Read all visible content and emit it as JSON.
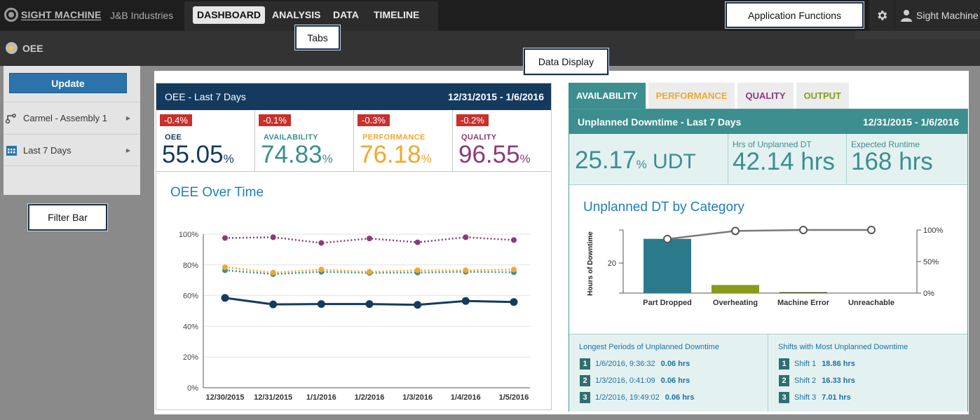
{
  "topbar": {
    "brand": "SIGHT MACHINE",
    "company": "J&B Industries",
    "tabs": [
      "DASHBOARD",
      "ANALYSIS",
      "DATA",
      "TIMELINE"
    ],
    "active_tab": "DASHBOARD",
    "user": "Sight Machine"
  },
  "secondary": {
    "title": "OEE"
  },
  "callouts": {
    "tabs": "Tabs",
    "app_functions": "Application Functions",
    "data_display": "Data Display",
    "filter_bar": "Filter Bar"
  },
  "filter": {
    "update_label": "Update",
    "items": [
      {
        "label": "Carmel - Assembly 1",
        "icon": "machine-icon"
      },
      {
        "label": "Last 7 Days",
        "icon": "calendar-icon"
      }
    ]
  },
  "oee_card": {
    "title": "OEE - Last 7 Days",
    "dates": "12/31/2015 - 1/6/2016",
    "kpis": [
      {
        "delta": "-0.4%",
        "label": "OEE",
        "value": "55.05",
        "unit": "%",
        "color": "#143a5e"
      },
      {
        "delta": "-0.1%",
        "label": "AVAILABILITY",
        "value": "74.83",
        "unit": "%",
        "color": "#3c8e8f"
      },
      {
        "delta": "-0.3%",
        "label": "PERFORMANCE",
        "value": "76.18",
        "unit": "%",
        "color": "#f0a830"
      },
      {
        "delta": "-0.2%",
        "label": "QUALITY",
        "value": "96.55",
        "unit": "%",
        "color": "#8b3a7a"
      }
    ],
    "chart_title": "OEE Over Time"
  },
  "right_card": {
    "tabs": [
      {
        "label": "AVAILABILITY",
        "color": "#ffffff"
      },
      {
        "label": "PERFORMANCE",
        "color": "#f0a830"
      },
      {
        "label": "QUALITY",
        "color": "#8b3a7a"
      },
      {
        "label": "OUTPUT",
        "color": "#8a9a1a"
      }
    ],
    "active_tab": "AVAILABILITY",
    "header_title": "Unplanned Downtime - Last 7 Days",
    "header_dates": "12/31/2015 - 1/6/2016",
    "kpi_main": {
      "value": "25.17",
      "pct": "%",
      "suffix": " UDT"
    },
    "kpi_hours": {
      "label": "Hrs of Unplanned DT",
      "value": "42.14 hrs"
    },
    "kpi_runtime": {
      "label": "Expected Runtime",
      "value": "168 hrs"
    },
    "chart_title": "Unplanned DT by Category",
    "longest": {
      "title": "Longest Periods of Unplanned Downtime",
      "rows": [
        {
          "n": "1",
          "time": "1/6/2016, 9:36:32",
          "value": "0.06 hrs"
        },
        {
          "n": "2",
          "time": "1/3/2016, 0:41:09",
          "value": "0.06 hrs"
        },
        {
          "n": "3",
          "time": "1/2/2016, 19:49:02",
          "value": "0.06 hrs"
        }
      ]
    },
    "shifts": {
      "title": "Shifts with Most Unplanned Downtime",
      "rows": [
        {
          "n": "1",
          "time": "Shift 1",
          "value": "18.86 hrs"
        },
        {
          "n": "2",
          "time": "Shift 2",
          "value": "16.33 hrs"
        },
        {
          "n": "3",
          "time": "Shift 3",
          "value": "7.01 hrs"
        }
      ]
    }
  },
  "chart_data": [
    {
      "type": "line",
      "title": "OEE Over Time",
      "x": [
        "12/30/2015",
        "12/31/2015",
        "1/1/2016",
        "1/2/2016",
        "1/3/2016",
        "1/4/2016",
        "1/5/2016"
      ],
      "ylim": [
        0,
        100
      ],
      "yticks": [
        "0%",
        "20%",
        "40%",
        "60%",
        "80%",
        "100%"
      ],
      "series": [
        {
          "key": "oee",
          "values": [
            58.5,
            54.3,
            54.5,
            54.5,
            54.0,
            56.5,
            55.8
          ],
          "color": "#143a5e",
          "style": "solid"
        },
        {
          "key": "availability",
          "values": [
            76.5,
            74.0,
            75.5,
            74.8,
            75.0,
            75.5,
            75.2
          ],
          "color": "#3c8e8f",
          "style": "dotted"
        },
        {
          "key": "performance",
          "values": [
            78.5,
            75.0,
            77.0,
            75.5,
            76.5,
            76.5,
            77.0
          ],
          "color": "#f0a830",
          "style": "dotted"
        },
        {
          "key": "quality",
          "values": [
            97.5,
            98.0,
            94.3,
            97.2,
            94.7,
            98.0,
            96.2
          ],
          "color": "#8b3a7a",
          "style": "dotted"
        }
      ],
      "grid": true
    },
    {
      "type": "bar",
      "title": "Unplanned DT by Category",
      "categories": [
        "Part Dropped",
        "Overheating",
        "Machine Error",
        "Unreachable"
      ],
      "values": [
        36.1,
        5.4,
        0.6,
        0
      ],
      "ylabel": "Hours of Downtime",
      "ylim": [
        0,
        42
      ],
      "yticks": [
        "20"
      ],
      "bar_colors": [
        "#2a7a8c",
        "#8a9a1a",
        "#4a4a1a",
        "#4a4a4a"
      ],
      "cumulative_pct": [
        85.7,
        98.5,
        100,
        100
      ],
      "y2ticks": [
        "0%",
        "50%",
        "100%"
      ]
    }
  ]
}
